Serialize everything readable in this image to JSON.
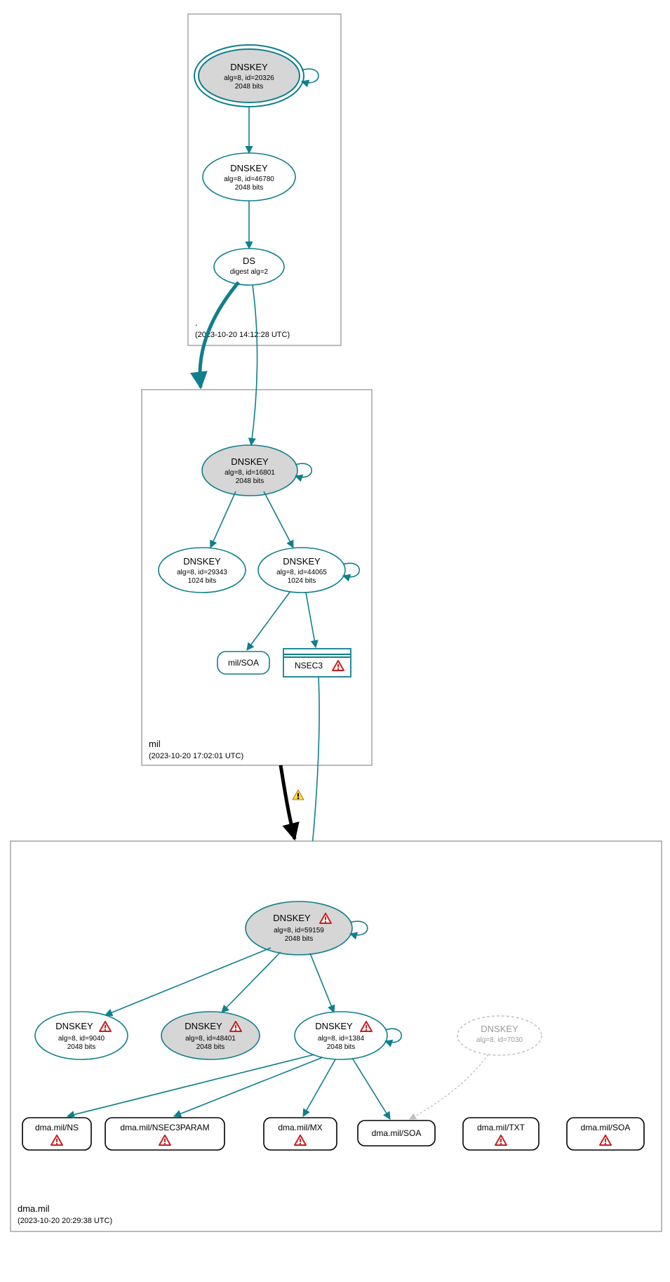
{
  "colors": {
    "teal": "#0f7f8c",
    "black": "#000",
    "gray": "#d6d6d6",
    "lightgray": "#bfbfbf"
  },
  "zones": {
    "root": {
      "label": ".",
      "ts": "(2023-10-20 14:12:28 UTC)"
    },
    "mil": {
      "label": "mil",
      "ts": "(2023-10-20 17:02:01 UTC)"
    },
    "dma": {
      "label": "dma.mil",
      "ts": "(2023-10-20 20:29:38 UTC)"
    }
  },
  "nodes": {
    "root_ksk": {
      "title": "DNSKEY",
      "l2": "alg=8, id=20326",
      "l3": "2048 bits"
    },
    "root_zsk": {
      "title": "DNSKEY",
      "l2": "alg=8, id=46780",
      "l3": "2048 bits"
    },
    "root_ds": {
      "title": "DS",
      "l2": "digest alg=2"
    },
    "mil_ksk": {
      "title": "DNSKEY",
      "l2": "alg=8, id=16801",
      "l3": "2048 bits"
    },
    "mil_zsk1": {
      "title": "DNSKEY",
      "l2": "alg=8, id=29343",
      "l3": "1024 bits"
    },
    "mil_zsk2": {
      "title": "DNSKEY",
      "l2": "alg=8, id=44065",
      "l3": "1024 bits"
    },
    "mil_soa": {
      "title": "mil/SOA"
    },
    "mil_nsec3": {
      "title": "NSEC3"
    },
    "dma_ksk": {
      "title": "DNSKEY",
      "l2": "alg=8, id=59159",
      "l3": "2048 bits"
    },
    "dma_k1": {
      "title": "DNSKEY",
      "l2": "alg=8, id=9040",
      "l3": "2048 bits"
    },
    "dma_k2": {
      "title": "DNSKEY",
      "l2": "alg=8, id=48401",
      "l3": "2048 bits"
    },
    "dma_k3": {
      "title": "DNSKEY",
      "l2": "alg=8, id=1384",
      "l3": "2048 bits"
    },
    "dma_k4": {
      "title": "DNSKEY",
      "l2": "alg=8, id=7030"
    },
    "dma_ns": {
      "title": "dma.mil/NS"
    },
    "dma_n3p": {
      "title": "dma.mil/NSEC3PARAM"
    },
    "dma_mx": {
      "title": "dma.mil/MX"
    },
    "dma_soa1": {
      "title": "dma.mil/SOA"
    },
    "dma_txt": {
      "title": "dma.mil/TXT"
    },
    "dma_soa2": {
      "title": "dma.mil/SOA"
    }
  }
}
